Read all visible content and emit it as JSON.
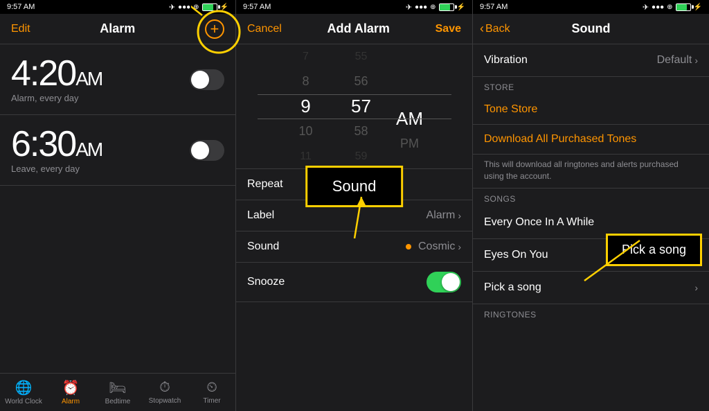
{
  "panel1": {
    "statusBar": {
      "time": "9:57 AM",
      "icons": "●●● ▲ ⊕ ▓ ⚡"
    },
    "navBar": {
      "editLabel": "Edit",
      "title": "Alarm",
      "addIcon": "+"
    },
    "alarms": [
      {
        "time": "4:20",
        "ampm": "AM",
        "label": "Alarm, every day",
        "enabled": false
      },
      {
        "time": "6:30",
        "ampm": "AM",
        "label": "Leave, every day",
        "enabled": false
      }
    ],
    "tabBar": {
      "tabs": [
        {
          "id": "world-clock",
          "label": "World Clock",
          "icon": "🌐",
          "active": false
        },
        {
          "id": "alarm",
          "label": "Alarm",
          "icon": "⏰",
          "active": true
        },
        {
          "id": "bedtime",
          "label": "Bedtime",
          "icon": "🛏",
          "active": false
        },
        {
          "id": "stopwatch",
          "label": "Stopwatch",
          "icon": "⏱",
          "active": false
        },
        {
          "id": "timer",
          "label": "Timer",
          "icon": "⏲",
          "active": false
        }
      ]
    }
  },
  "panel2": {
    "statusBar": {
      "time": "9:57 AM"
    },
    "navBar": {
      "cancelLabel": "Cancel",
      "title": "Add Alarm",
      "saveLabel": "Save"
    },
    "picker": {
      "hours": [
        "7",
        "8",
        "9",
        "10",
        "11"
      ],
      "selectedHour": "9",
      "minutes": [
        "55",
        "56",
        "57",
        "58",
        "59"
      ],
      "selectedMinute": "57",
      "periods": [
        "AM",
        "PM"
      ],
      "selectedPeriod": "AM"
    },
    "options": [
      {
        "label": "Repeat",
        "value": "",
        "hasChevron": false,
        "hasToggle": false
      },
      {
        "label": "Label",
        "value": "Alarm",
        "hasChevron": true,
        "hasToggle": false
      },
      {
        "label": "Sound",
        "value": "Cosmic",
        "hasChevron": true,
        "hasToggle": false,
        "hasDot": true
      },
      {
        "label": "Snooze",
        "value": "",
        "hasChevron": false,
        "hasToggle": true
      }
    ],
    "soundAnnotation": "Sound"
  },
  "panel3": {
    "statusBar": {
      "time": "9:57 AM"
    },
    "navBar": {
      "backLabel": "Back",
      "title": "Sound"
    },
    "vibration": {
      "label": "Vibration",
      "value": "Default"
    },
    "store": {
      "sectionLabel": "STORE",
      "toneStoreLabel": "Tone Store",
      "downloadLabel": "Download All Purchased Tones",
      "downloadDesc": "This will download all ringtones and alerts purchased using the account."
    },
    "songs": {
      "sectionLabel": "SONGS",
      "items": [
        {
          "name": "Every Once In A While",
          "hasChevron": false
        },
        {
          "name": "Eyes On You",
          "hasChevron": false
        },
        {
          "name": "Pick a song",
          "hasChevron": true
        }
      ]
    },
    "ringtones": {
      "sectionLabel": "RINGTONES"
    },
    "pickAnnotation": "Pick a song"
  }
}
